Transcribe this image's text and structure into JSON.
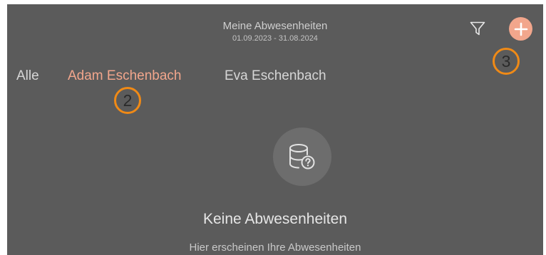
{
  "header": {
    "title": "Meine Abwesenheiten",
    "date_range": "01.09.2023 - 31.08.2024",
    "filter_icon": "filter-icon",
    "add_icon": "plus-icon"
  },
  "tabs": [
    {
      "label": "Alle",
      "active": false
    },
    {
      "label": "Adam Eschenbach",
      "active": true
    },
    {
      "label": "Eva Eschenbach",
      "active": false
    }
  ],
  "callouts": [
    "2",
    "3"
  ],
  "empty_state": {
    "icon": "database-question-icon",
    "title": "Keine Abwesenheiten",
    "subtitle": "Hier erscheinen Ihre Abwesenheiten"
  },
  "colors": {
    "background": "#5b5b5b",
    "accent": "#f2a68c",
    "callout_ring": "#f08a16"
  }
}
